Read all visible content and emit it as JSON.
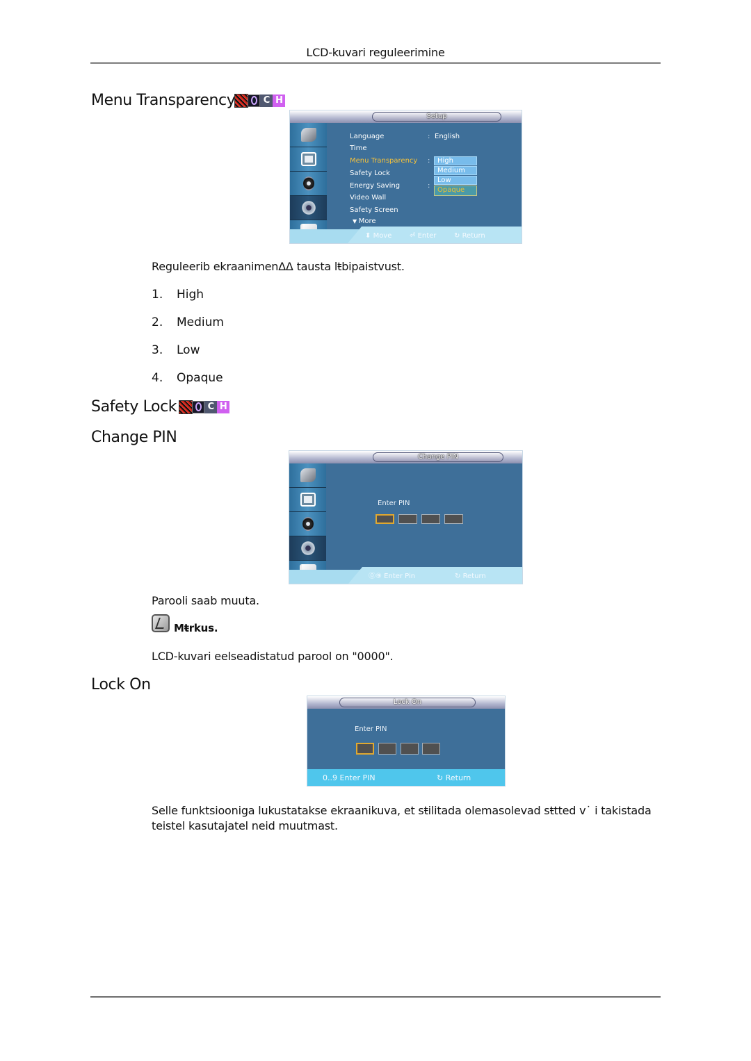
{
  "header": {
    "title": "LCD-kuvari reguleerimine"
  },
  "sections": {
    "menu_transparency": {
      "heading": "Menu Transparency",
      "badges": [
        "magic-info-badge",
        "o-badge",
        "C",
        "H"
      ],
      "osd": {
        "title": "Setup",
        "sidebar_icons": [
          "tools-icon",
          "picture-icon",
          "sound-icon",
          "setup-gear-icon",
          "multimedia-icon"
        ],
        "active_sidebar_index": 3,
        "items": [
          {
            "label": "Language",
            "value": "English"
          },
          {
            "label": "Time",
            "value": ""
          },
          {
            "label": "Menu Transparency",
            "value": ""
          },
          {
            "label": "Safety Lock",
            "value": ""
          },
          {
            "label": "Energy Saving",
            "value": ""
          },
          {
            "label": "Video Wall",
            "value": ""
          },
          {
            "label": "Safety Screen",
            "value": ""
          },
          {
            "label": "More",
            "value": ""
          }
        ],
        "dropdown": [
          "High",
          "Medium",
          "Low",
          "Opaque"
        ],
        "dropdown_selected": "Opaque",
        "hints": {
          "move": "Move",
          "enter": "Enter",
          "return": "Return"
        }
      },
      "description": "Reguleerib ekraanimenΔΔ tausta lŧbipaistvust.",
      "list": [
        {
          "num": "1.",
          "label": "High"
        },
        {
          "num": "2.",
          "label": "Medium"
        },
        {
          "num": "3.",
          "label": "Low"
        },
        {
          "num": "4.",
          "label": "Opaque"
        }
      ]
    },
    "safety_lock": {
      "heading": "Safety Lock",
      "badges": [
        "magic-info-badge",
        "o-badge",
        "C",
        "H"
      ]
    },
    "change_pin": {
      "heading": "Change PIN",
      "osd": {
        "title": "Change PIN",
        "pin_label": "Enter PIN",
        "pin_count": 4,
        "hints": {
          "digits": "0..9",
          "enter": "Enter Pin",
          "return": "Return"
        }
      },
      "description": "Parooli saab muuta.",
      "note_label": "Mŧrkus.",
      "note_text": "LCD-kuvari eelseadistatud parool on \"0000\"."
    },
    "lock_on": {
      "heading": "Lock On",
      "osd": {
        "title": "Lock On",
        "pin_label": "Enter PIN",
        "hints": {
          "digits": "0..9",
          "enter": "Enter PIN",
          "return": "Return"
        }
      },
      "description": "Selle funktsiooniga lukustatakse ekraanikuva, et sŧilitada olemasolevad sŧtted v˙ i takistada teistel kasutajatel neid muutmast."
    }
  }
}
